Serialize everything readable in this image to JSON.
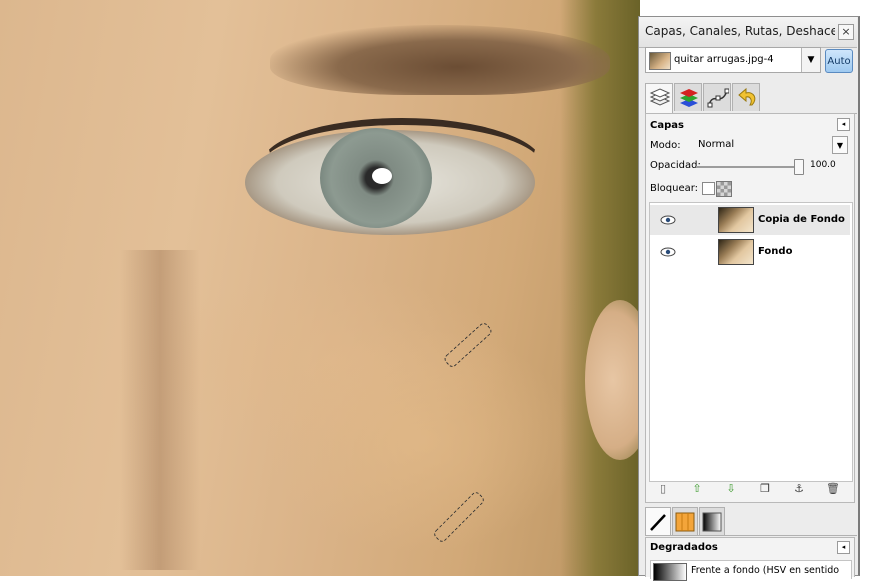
{
  "dock": {
    "title": "Capas, Canales, Rutas, Deshacer - ...",
    "close_glyph": "×",
    "image_selector": {
      "value": "quitar arrugas.jpg-4",
      "arrow": "▼"
    },
    "auto_button": "Auto",
    "tabs": [
      {
        "icon": "layers-icon",
        "active": true
      },
      {
        "icon": "channels-icon",
        "active": false
      },
      {
        "icon": "paths-icon",
        "active": false
      },
      {
        "icon": "undo-icon",
        "active": false
      }
    ]
  },
  "layers": {
    "panel_title": "Capas",
    "menu_glyph": "◂",
    "mode_label": "Modo:",
    "mode_value": "Normal",
    "mode_arrow": "▼",
    "opacity_label": "Opacidad:",
    "opacity_value": "100.0",
    "lock_label": "Bloquear:",
    "items": [
      {
        "name": "Copia de Fondo",
        "visible": true,
        "selected": true
      },
      {
        "name": "Fondo",
        "visible": true,
        "selected": false
      }
    ],
    "buttons": [
      {
        "icon": "new-layer-icon",
        "glyph": "▯"
      },
      {
        "icon": "raise-layer-icon",
        "glyph": "⇧"
      },
      {
        "icon": "lower-layer-icon",
        "glyph": "⇩"
      },
      {
        "icon": "duplicate-layer-icon",
        "glyph": "❐"
      },
      {
        "icon": "anchor-layer-icon",
        "glyph": "⚓"
      },
      {
        "icon": "delete-layer-icon",
        "glyph": "🗑"
      }
    ]
  },
  "bottom_tabs": [
    {
      "icon": "brushes-icon",
      "active": true
    },
    {
      "icon": "patterns-icon",
      "active": false
    },
    {
      "icon": "gradients-icon",
      "active": false
    }
  ],
  "gradients": {
    "panel_title": "Degradados",
    "menu_glyph": "◂",
    "item_name": "Frente a fondo (HSV en sentido"
  }
}
